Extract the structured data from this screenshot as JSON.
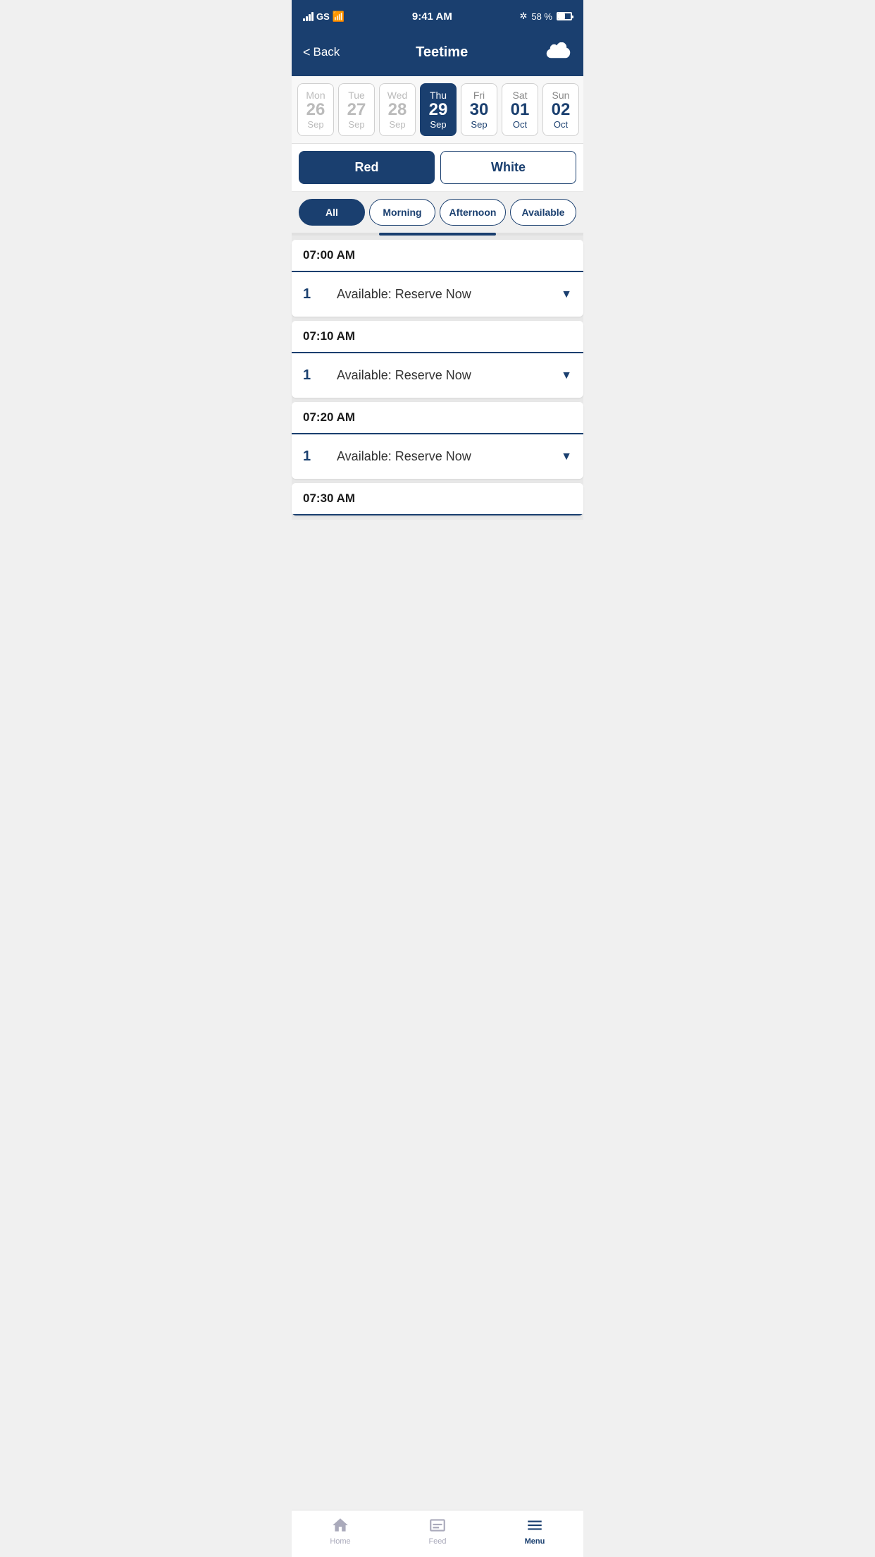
{
  "statusBar": {
    "carrier": "GS",
    "time": "9:41 AM",
    "bluetooth": "BT",
    "battery_pct": "58 %"
  },
  "header": {
    "back_label": "Back",
    "title": "Teetime",
    "cloud_icon": "cloud"
  },
  "calendar": {
    "days": [
      {
        "id": "mon-26-sep",
        "dayName": "Mon",
        "dayNum": "26",
        "month": "Sep",
        "active": false,
        "muted": true
      },
      {
        "id": "tue-27-sep",
        "dayName": "Tue",
        "dayNum": "27",
        "month": "Sep",
        "active": false,
        "muted": true
      },
      {
        "id": "wed-28-sep",
        "dayName": "Wed",
        "dayNum": "28",
        "month": "Sep",
        "active": false,
        "muted": true
      },
      {
        "id": "thu-29-sep",
        "dayName": "Thu",
        "dayNum": "29",
        "month": "Sep",
        "active": true,
        "muted": false
      },
      {
        "id": "fri-30-sep",
        "dayName": "Fri",
        "dayNum": "30",
        "month": "Sep",
        "active": false,
        "muted": false
      },
      {
        "id": "sat-01-oct",
        "dayName": "Sat",
        "dayNum": "01",
        "month": "Oct",
        "active": false,
        "muted": false
      },
      {
        "id": "sun-02-oct",
        "dayName": "Sun",
        "dayNum": "02",
        "month": "Oct",
        "active": false,
        "muted": false
      }
    ]
  },
  "courseSelector": {
    "buttons": [
      {
        "id": "red",
        "label": "Red",
        "active": true
      },
      {
        "id": "white",
        "label": "White",
        "active": false
      }
    ]
  },
  "filterBar": {
    "buttons": [
      {
        "id": "all",
        "label": "All",
        "active": true
      },
      {
        "id": "morning",
        "label": "Morning",
        "active": false
      },
      {
        "id": "afternoon",
        "label": "Afternoon",
        "active": false
      },
      {
        "id": "available",
        "label": "Available",
        "active": false
      }
    ]
  },
  "teeSlots": [
    {
      "id": "slot-0700",
      "time": "07:00 AM",
      "rows": [
        {
          "num": "1",
          "label": "Available: Reserve Now"
        }
      ]
    },
    {
      "id": "slot-0710",
      "time": "07:10 AM",
      "rows": [
        {
          "num": "1",
          "label": "Available: Reserve Now"
        }
      ]
    },
    {
      "id": "slot-0720",
      "time": "07:20 AM",
      "rows": [
        {
          "num": "1",
          "label": "Available: Reserve Now"
        }
      ]
    },
    {
      "id": "slot-0730",
      "time": "07:30 AM",
      "rows": []
    }
  ],
  "tabBar": {
    "tabs": [
      {
        "id": "home",
        "icon": "home",
        "label": "Home",
        "active": false
      },
      {
        "id": "feed",
        "icon": "feed",
        "label": "Feed",
        "active": false
      },
      {
        "id": "menu",
        "icon": "menu",
        "label": "Menu",
        "active": true
      }
    ]
  }
}
